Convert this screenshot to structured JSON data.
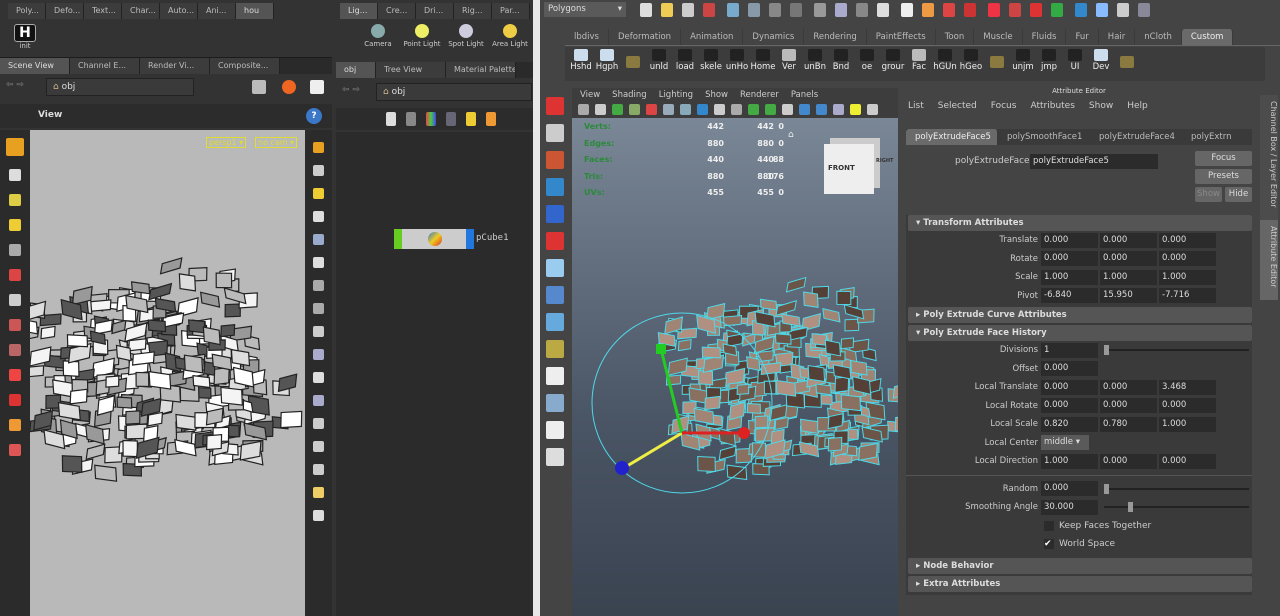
{
  "houdini": {
    "shelf_tabs_left": [
      "Poly...",
      "Defo...",
      "Text...",
      "Char...",
      "Auto...",
      "Ani...",
      "hou"
    ],
    "shelf_tool": {
      "label": "init",
      "glyph": "H"
    },
    "shelf_tabs_right": [
      "Lig...",
      "Cre...",
      "Dri...",
      "Rig...",
      "Par..."
    ],
    "light_tools": [
      {
        "label": "Camera",
        "color": "#8aa"
      },
      {
        "label": "Point Light",
        "color": "#ee6"
      },
      {
        "label": "Spot Light",
        "color": "#ccd"
      },
      {
        "label": "Area Light",
        "color": "#ec4"
      }
    ],
    "pane_tabs_left": [
      "Scene View",
      "Channel E...",
      "Render Vi...",
      "Composite..."
    ],
    "pane_tabs_right": [
      "obj",
      "Tree View",
      "Material Palette"
    ],
    "path_left": "obj",
    "path_right": "obj",
    "viewport_title": "View",
    "camera_menu": "persp1",
    "cam_menu": "no cam",
    "node_name": "pCube1"
  },
  "maya": {
    "menu_set": "Polygons",
    "shelf_tabs": [
      "lbdivs",
      "Deformation",
      "Animation",
      "Dynamics",
      "Rendering",
      "PaintEffects",
      "Toon",
      "Muscle",
      "Fluids",
      "Fur",
      "Hair",
      "nCloth",
      "Custom"
    ],
    "active_shelf_tab": "Custom",
    "shelf_items": [
      "Hshd",
      "Hgph",
      "",
      "unld",
      "load",
      "skele",
      "unHo",
      "Home",
      "Ver",
      "unBn",
      "Bnd",
      "oe",
      "grour",
      "Fac",
      "hGUn",
      "hGeo",
      "",
      "unjm",
      "jmp",
      "UI",
      "Dev",
      ""
    ],
    "panel_menu": [
      "View",
      "Shading",
      "Lighting",
      "Show",
      "Renderer",
      "Panels"
    ],
    "stats": [
      {
        "label": "Verts:",
        "a": "442",
        "b": "442",
        "c": "0"
      },
      {
        "label": "Edges:",
        "a": "880",
        "b": "880",
        "c": "0"
      },
      {
        "label": "Faces:",
        "a": "440",
        "b": "440",
        "c": "88"
      },
      {
        "label": "Tris:",
        "a": "880",
        "b": "880",
        "c": "176"
      },
      {
        "label": "UVs:",
        "a": "455",
        "b": "455",
        "c": "0"
      }
    ],
    "viewcube": {
      "front": "FRONT",
      "right": "RIGHT"
    },
    "attr_editor": {
      "title": "Attribute Editor",
      "menu": [
        "List",
        "Selected",
        "Focus",
        "Attributes",
        "Show",
        "Help"
      ],
      "tabs": [
        "polyExtrudeFace5",
        "polySmoothFace1",
        "polyExtrudeFace4",
        "polyExtrn"
      ],
      "node_label": "polyExtrudeFace:",
      "node_value": "polyExtrudeFace5",
      "focus": "Focus",
      "presets": "Presets",
      "show": "Show",
      "hide": "Hide",
      "transform_section": "Transform Attributes",
      "transform_rows": [
        {
          "label": "Translate",
          "v": [
            "0.000",
            "0.000",
            "0.000"
          ]
        },
        {
          "label": "Rotate",
          "v": [
            "0.000",
            "0.000",
            "0.000"
          ]
        },
        {
          "label": "Scale",
          "v": [
            "1.000",
            "1.000",
            "1.000"
          ]
        },
        {
          "label": "Pivot",
          "v": [
            "-6.840",
            "15.950",
            "-7.716"
          ]
        }
      ],
      "curve_section": "Poly Extrude Curve Attributes",
      "face_section": "Poly Extrude Face History",
      "divisions": {
        "label": "Divisions",
        "v": "1",
        "slider": 0
      },
      "offset": {
        "label": "Offset",
        "v": "0.000"
      },
      "face_rows": [
        {
          "label": "Local Translate",
          "v": [
            "0.000",
            "0.000",
            "3.468"
          ]
        },
        {
          "label": "Local Rotate",
          "v": [
            "0.000",
            "0.000",
            "0.000"
          ]
        },
        {
          "label": "Local Scale",
          "v": [
            "0.820",
            "0.780",
            "1.000"
          ]
        }
      ],
      "local_center": {
        "label": "Local Center",
        "v": "middle"
      },
      "local_direction": {
        "label": "Local Direction",
        "v": [
          "1.000",
          "0.000",
          "0.000"
        ]
      },
      "random": {
        "label": "Random",
        "v": "0.000",
        "slider": 0
      },
      "smoothing": {
        "label": "Smoothing Angle",
        "v": "30.000",
        "slider": 0.17
      },
      "keep_faces": {
        "label": "Keep Faces Together",
        "checked": false
      },
      "world_space": {
        "label": "World Space",
        "checked": true
      },
      "node_behavior": "Node Behavior",
      "extra": "Extra Attributes"
    },
    "side_tabs": [
      "Channel Box / Layer Editor",
      "Attribute Editor"
    ]
  }
}
